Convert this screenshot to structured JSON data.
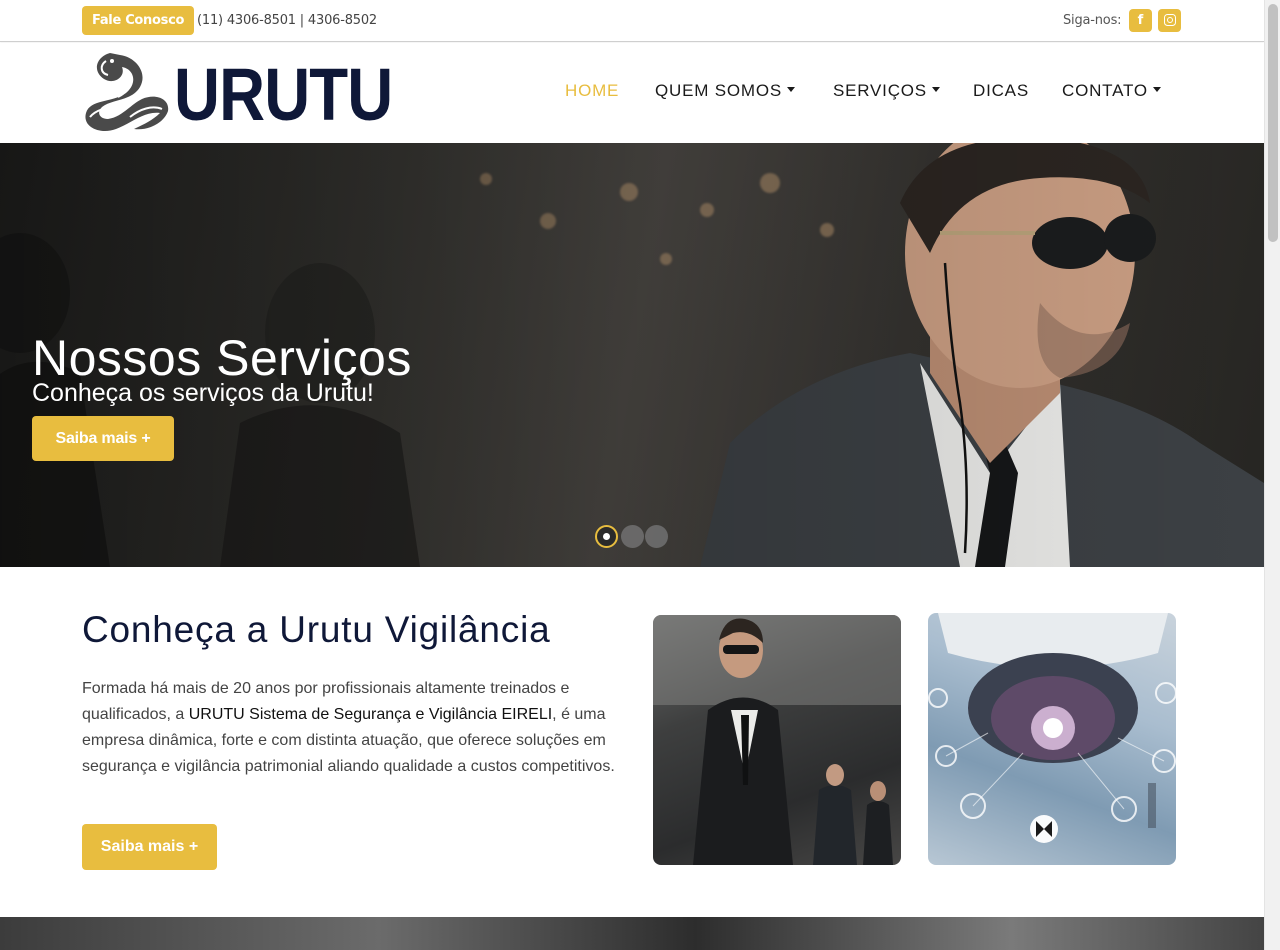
{
  "topbar": {
    "contact_button": "Fale Conosco",
    "phones": "(11) 4306-8501 | 4306-8502",
    "follow_label": "Siga-nos:",
    "facebook_icon": "facebook-icon",
    "instagram_icon": "instagram-icon"
  },
  "header": {
    "logo_text": "URUTU",
    "nav": [
      {
        "label": "HOME",
        "active": true,
        "dropdown": false
      },
      {
        "label": "QUEM SOMOS",
        "active": false,
        "dropdown": true
      },
      {
        "label": "SERVIÇOS",
        "active": false,
        "dropdown": true
      },
      {
        "label": "DICAS",
        "active": false,
        "dropdown": false
      },
      {
        "label": "CONTATO",
        "active": false,
        "dropdown": true
      }
    ]
  },
  "hero": {
    "title": "Nossos Serviços",
    "subtitle": "Conheça os serviços da Urutu!",
    "button": "Saiba mais +",
    "slide_count": 3,
    "active_slide": 1
  },
  "about": {
    "title": "Conheça a Urutu Vigilância",
    "text_before": "Formada há mais de 20 anos por profissionais altamente treinados e qualificados, a ",
    "text_bold": "URUTU Sistema de Segurança e Vigilância EIRELI",
    "text_after": ", é uma empresa dinâmica, forte e com distinta atuação, que oferece soluções em segurança e vigilância patrimonial aliando qualidade a custos competitivos.",
    "button": "Saiba mais +"
  },
  "colors": {
    "accent": "#e8bd3f",
    "navy": "#0f1838"
  }
}
